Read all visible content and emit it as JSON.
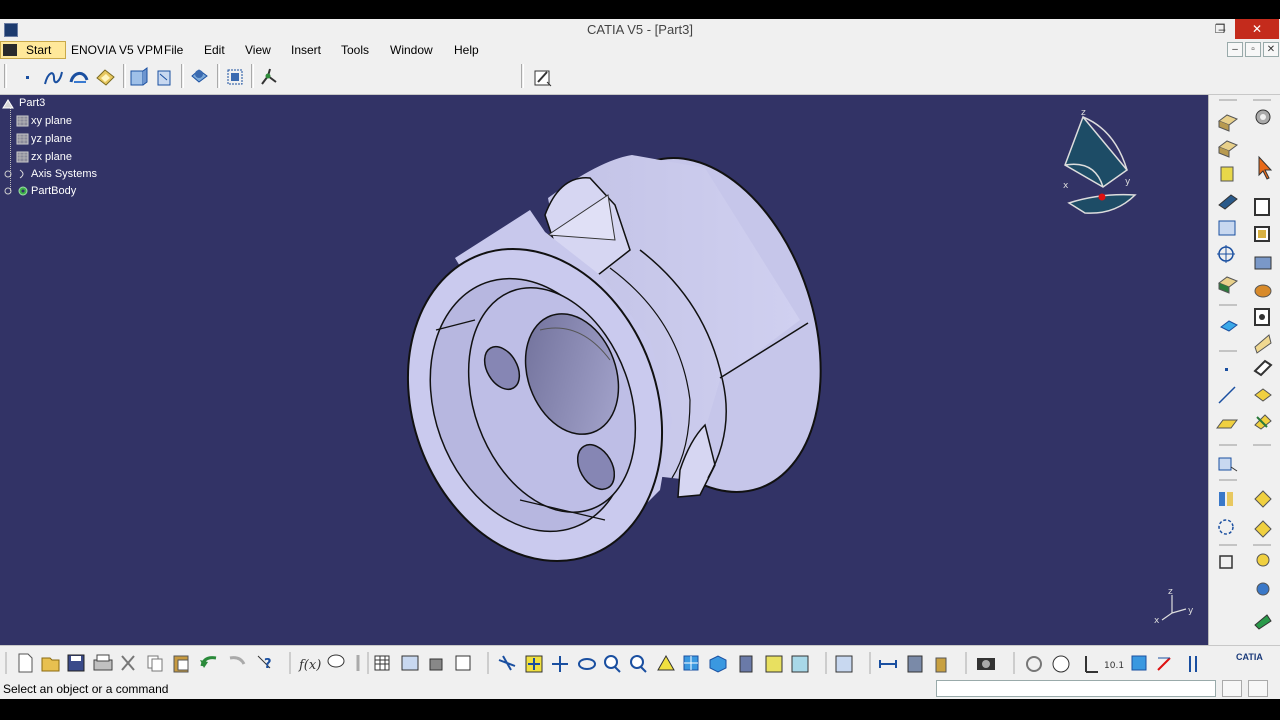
{
  "window": {
    "title": "CATIA V5 - [Part3]",
    "minimize": "–",
    "maximize": "❐",
    "close": "✕"
  },
  "menu": {
    "start": "Start",
    "items": [
      "ENOVIA V5 VPM",
      "File",
      "Edit",
      "View",
      "Insert",
      "Tools",
      "Window",
      "Help"
    ],
    "doc_controls": [
      "–",
      "▫",
      "✕"
    ]
  },
  "tree": {
    "root": "Part3",
    "items": [
      "xy plane",
      "yz plane",
      "zx plane",
      "Axis Systems",
      "PartBody"
    ]
  },
  "compass": {
    "x": "x",
    "y": "y",
    "z": "z"
  },
  "triad": {
    "x": "x",
    "y": "y",
    "z": "z"
  },
  "logo": "CATIA",
  "status": {
    "message": "Select an object or a command",
    "command_input": ""
  },
  "colors": {
    "viewport_bg": "#323366",
    "part_fill": "#c8c8ec",
    "toolbar_bg": "#f0f0f0",
    "close_red": "#c42b1c"
  }
}
